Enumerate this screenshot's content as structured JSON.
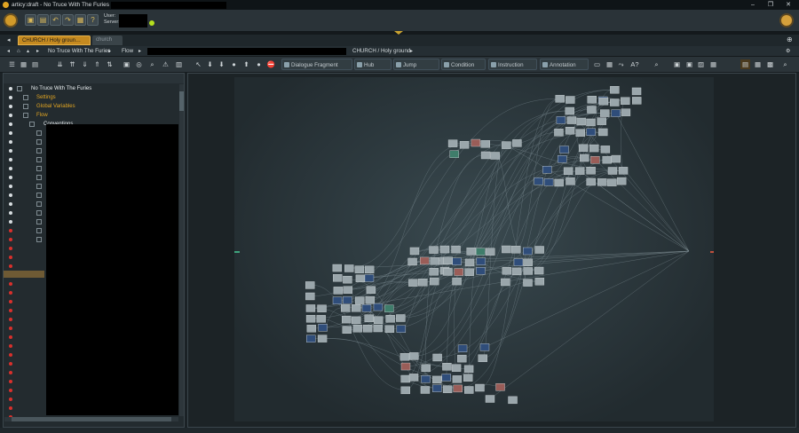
{
  "window": {
    "title": "articy:draft - No Truce With The Furies",
    "controls": [
      "–",
      "❐",
      "✕"
    ]
  },
  "header": {
    "user_label": "User:",
    "server_label": "Server:"
  },
  "tabs": [
    {
      "label": "CHURCH / Holy groun…",
      "active": true
    },
    {
      "label": "church",
      "active": false
    }
  ],
  "navbar": {
    "breadcrumb_project": "No Truce With The Furies",
    "breadcrumb_flow": "Flow",
    "location": "CHURCH / Holy ground"
  },
  "toolbar": {
    "tools": [
      "Dialogue Fragment",
      "Hub",
      "Jump",
      "Condition",
      "Instruction",
      "Annotation"
    ],
    "arrow_symbol": "A?"
  },
  "tree": {
    "items": [
      {
        "label": "No Truce With The Furies",
        "style": "root"
      },
      {
        "label": "Settings",
        "style": "orange"
      },
      {
        "label": "Global Variables",
        "style": "orange"
      },
      {
        "label": "Flow",
        "style": "orange"
      },
      {
        "label": "Conventions",
        "style": "normal"
      }
    ]
  },
  "colors": {
    "accent": "#c58a20",
    "status_online": "#b5e01e",
    "flag_red": "#d8302c"
  }
}
